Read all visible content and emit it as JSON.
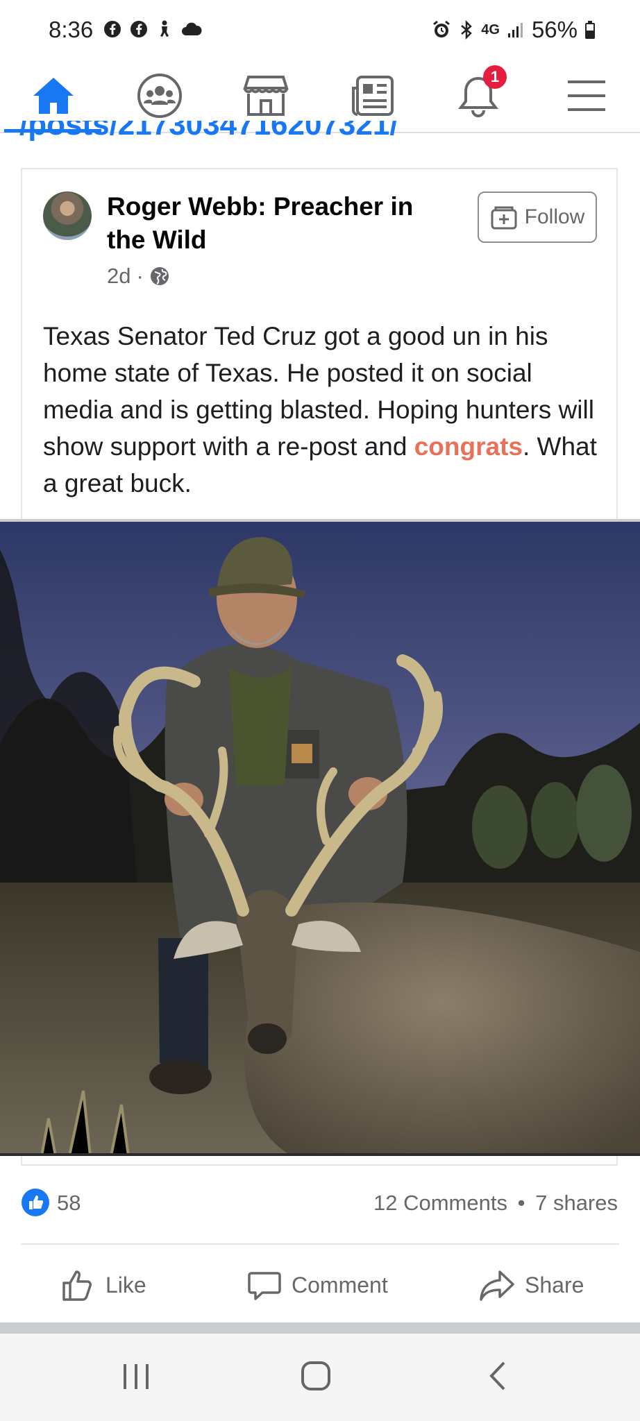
{
  "status_bar": {
    "time": "8:36",
    "battery": "56%",
    "network": "4G"
  },
  "nav": {
    "items": [
      {
        "icon": "home-icon",
        "active": true
      },
      {
        "icon": "groups-icon",
        "active": false
      },
      {
        "icon": "marketplace-icon",
        "active": false
      },
      {
        "icon": "news-feed-icon",
        "active": false
      },
      {
        "icon": "notifications-icon",
        "active": false,
        "badge": "1"
      },
      {
        "icon": "menu-icon",
        "active": false
      }
    ],
    "accent": "#1877f2"
  },
  "url_fragment": "/posts/2173034716207321/",
  "post": {
    "author": "Roger Webb: Preacher in the Wild",
    "time": "2d",
    "separator": "·",
    "follow_label": "Follow",
    "text_before": "Texas Senator Ted Cruz got a good un in his home state of Texas. He posted it on social media and is getting blasted. Hoping hunters will show support with a re-post and ",
    "text_highlight": "congrats",
    "text_after": ". What a great buck.",
    "highlight_color": "#e8715a"
  },
  "stats": {
    "likes": "58",
    "comments": "12 Comments",
    "dot": "•",
    "shares": "7 shares"
  },
  "actions": {
    "like": "Like",
    "comment": "Comment",
    "share": "Share"
  }
}
